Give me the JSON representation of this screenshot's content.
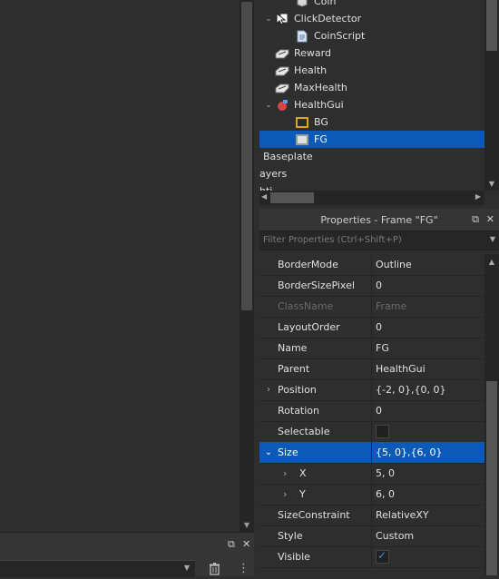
{
  "explorer": {
    "items": [
      {
        "label": "Coin",
        "icon": "part-icon",
        "expand": "",
        "indent": 2
      },
      {
        "label": "ClickDetector",
        "icon": "click-detector-icon",
        "expand": "v",
        "indent": 1
      },
      {
        "label": "CoinScript",
        "icon": "script-icon",
        "expand": "",
        "indent": 2
      },
      {
        "label": "Reward",
        "icon": "value-icon",
        "expand": "",
        "indent": 1
      },
      {
        "label": "Health",
        "icon": "value-icon",
        "expand": "",
        "indent": 1
      },
      {
        "label": "MaxHealth",
        "icon": "value-icon",
        "expand": "",
        "indent": 1
      },
      {
        "label": "HealthGui",
        "icon": "billboard-gui-icon",
        "expand": "v",
        "indent": 1
      },
      {
        "label": "BG",
        "icon": "frame-icon-orange",
        "expand": "",
        "indent": 2
      },
      {
        "label": "FG",
        "icon": "frame-icon-gray",
        "expand": "",
        "indent": 2,
        "selected": true
      },
      {
        "label": "Baseplate",
        "icon": "",
        "expand": "",
        "indent": 0
      },
      {
        "label": "ayers",
        "icon": "",
        "expand": "",
        "indent": -1
      },
      {
        "label": "hti",
        "icon": "",
        "expand": "",
        "indent": -1
      }
    ]
  },
  "properties": {
    "title": "Properties - Frame \"FG\"",
    "filter_placeholder": "Filter Properties (Ctrl+Shift+P)",
    "rows": [
      {
        "name": "BorderMode",
        "value": "Outline"
      },
      {
        "name": "BorderSizePixel",
        "value": "0"
      },
      {
        "name": "ClassName",
        "value": "Frame",
        "disabled": true
      },
      {
        "name": "LayoutOrder",
        "value": "0"
      },
      {
        "name": "Name",
        "value": "FG"
      },
      {
        "name": "Parent",
        "value": "HealthGui"
      },
      {
        "name": "Position",
        "value": "{-2, 0},{0, 0}",
        "expand": ">"
      },
      {
        "name": "Rotation",
        "value": "0"
      },
      {
        "name": "Selectable",
        "value": "",
        "checkbox": false
      },
      {
        "name": "Size",
        "value": "{5, 0},{6, 0}",
        "expand": "v",
        "selected": true
      },
      {
        "name": "X",
        "value": "5, 0",
        "expand": ">",
        "sub": true
      },
      {
        "name": "Y",
        "value": "6, 0",
        "expand": ">",
        "sub": true
      },
      {
        "name": "SizeConstraint",
        "value": "RelativeXY"
      },
      {
        "name": "Style",
        "value": "Custom"
      },
      {
        "name": "Visible",
        "value": "",
        "checkbox": true
      }
    ]
  },
  "colors": {
    "selection": "#0b5ab8",
    "background": "#2e2e2e",
    "checkbox_check": "#3d8bd9"
  }
}
